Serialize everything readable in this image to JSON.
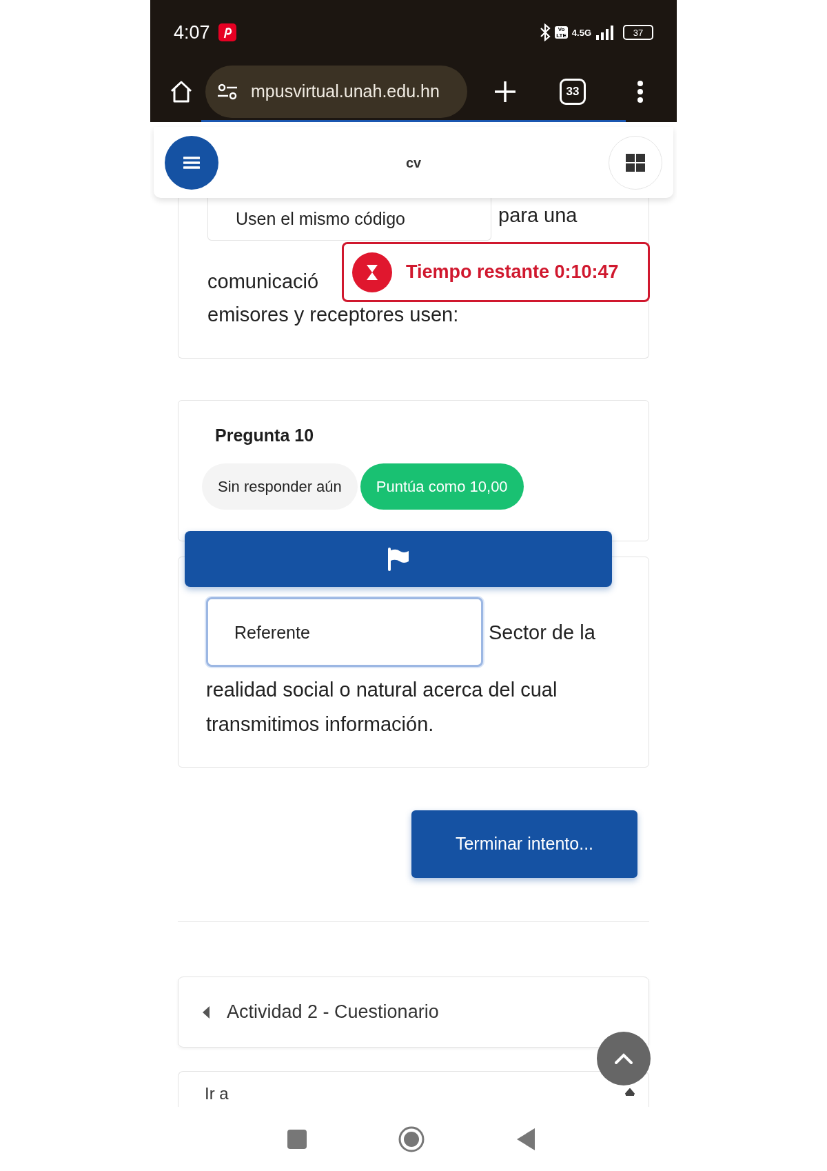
{
  "status_bar": {
    "time": "4:07",
    "volte": [
      "Vo",
      "LTE"
    ],
    "network": "4.5G",
    "battery": "37"
  },
  "browser": {
    "url": "mpusvirtual.unah.edu.hn",
    "tab_count": "33"
  },
  "header": {
    "title": "cv"
  },
  "question_9": {
    "option": "Usen el mismo código",
    "text_lines": [
      "para una",
      "comunicació",
      "emisores y receptores usen:"
    ]
  },
  "timer": {
    "label": "Tiempo restante 0:10:47"
  },
  "question_10": {
    "title": "Pregunta 10",
    "status": "Sin responder aún",
    "grade": "Puntúa como 10,00",
    "flagged": false,
    "answer": "Referente",
    "text_lines": [
      "Sector de la",
      "realidad social o natural acerca del cual transmitimos información."
    ]
  },
  "finish_button": "Terminar intento...",
  "previous_activity": "Actividad 2 - Cuestionario",
  "jump_to": "Ir a"
}
